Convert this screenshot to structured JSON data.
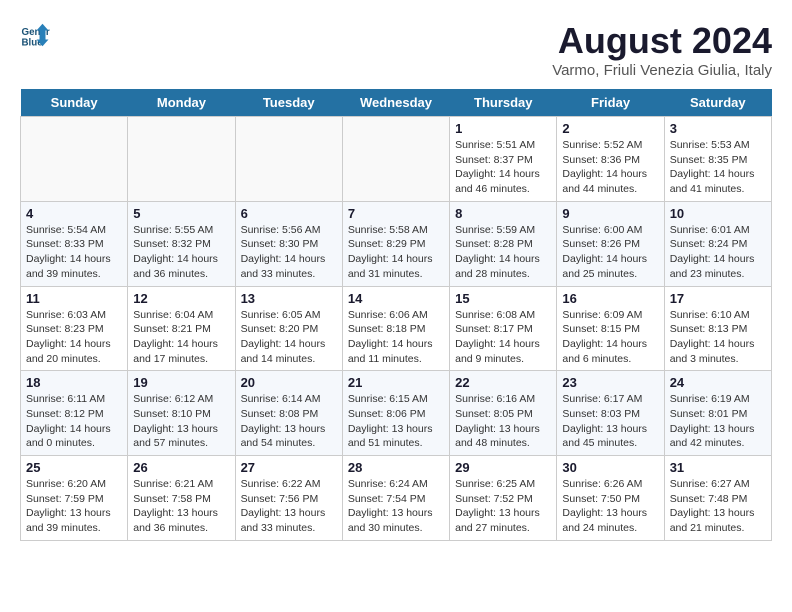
{
  "header": {
    "logo_line1": "General",
    "logo_line2": "Blue",
    "month_year": "August 2024",
    "location": "Varmo, Friuli Venezia Giulia, Italy"
  },
  "days_of_week": [
    "Sunday",
    "Monday",
    "Tuesday",
    "Wednesday",
    "Thursday",
    "Friday",
    "Saturday"
  ],
  "weeks": [
    [
      {
        "day": "",
        "info": ""
      },
      {
        "day": "",
        "info": ""
      },
      {
        "day": "",
        "info": ""
      },
      {
        "day": "",
        "info": ""
      },
      {
        "day": "1",
        "info": "Sunrise: 5:51 AM\nSunset: 8:37 PM\nDaylight: 14 hours and 46 minutes."
      },
      {
        "day": "2",
        "info": "Sunrise: 5:52 AM\nSunset: 8:36 PM\nDaylight: 14 hours and 44 minutes."
      },
      {
        "day": "3",
        "info": "Sunrise: 5:53 AM\nSunset: 8:35 PM\nDaylight: 14 hours and 41 minutes."
      }
    ],
    [
      {
        "day": "4",
        "info": "Sunrise: 5:54 AM\nSunset: 8:33 PM\nDaylight: 14 hours and 39 minutes."
      },
      {
        "day": "5",
        "info": "Sunrise: 5:55 AM\nSunset: 8:32 PM\nDaylight: 14 hours and 36 minutes."
      },
      {
        "day": "6",
        "info": "Sunrise: 5:56 AM\nSunset: 8:30 PM\nDaylight: 14 hours and 33 minutes."
      },
      {
        "day": "7",
        "info": "Sunrise: 5:58 AM\nSunset: 8:29 PM\nDaylight: 14 hours and 31 minutes."
      },
      {
        "day": "8",
        "info": "Sunrise: 5:59 AM\nSunset: 8:28 PM\nDaylight: 14 hours and 28 minutes."
      },
      {
        "day": "9",
        "info": "Sunrise: 6:00 AM\nSunset: 8:26 PM\nDaylight: 14 hours and 25 minutes."
      },
      {
        "day": "10",
        "info": "Sunrise: 6:01 AM\nSunset: 8:24 PM\nDaylight: 14 hours and 23 minutes."
      }
    ],
    [
      {
        "day": "11",
        "info": "Sunrise: 6:03 AM\nSunset: 8:23 PM\nDaylight: 14 hours and 20 minutes."
      },
      {
        "day": "12",
        "info": "Sunrise: 6:04 AM\nSunset: 8:21 PM\nDaylight: 14 hours and 17 minutes."
      },
      {
        "day": "13",
        "info": "Sunrise: 6:05 AM\nSunset: 8:20 PM\nDaylight: 14 hours and 14 minutes."
      },
      {
        "day": "14",
        "info": "Sunrise: 6:06 AM\nSunset: 8:18 PM\nDaylight: 14 hours and 11 minutes."
      },
      {
        "day": "15",
        "info": "Sunrise: 6:08 AM\nSunset: 8:17 PM\nDaylight: 14 hours and 9 minutes."
      },
      {
        "day": "16",
        "info": "Sunrise: 6:09 AM\nSunset: 8:15 PM\nDaylight: 14 hours and 6 minutes."
      },
      {
        "day": "17",
        "info": "Sunrise: 6:10 AM\nSunset: 8:13 PM\nDaylight: 14 hours and 3 minutes."
      }
    ],
    [
      {
        "day": "18",
        "info": "Sunrise: 6:11 AM\nSunset: 8:12 PM\nDaylight: 14 hours and 0 minutes."
      },
      {
        "day": "19",
        "info": "Sunrise: 6:12 AM\nSunset: 8:10 PM\nDaylight: 13 hours and 57 minutes."
      },
      {
        "day": "20",
        "info": "Sunrise: 6:14 AM\nSunset: 8:08 PM\nDaylight: 13 hours and 54 minutes."
      },
      {
        "day": "21",
        "info": "Sunrise: 6:15 AM\nSunset: 8:06 PM\nDaylight: 13 hours and 51 minutes."
      },
      {
        "day": "22",
        "info": "Sunrise: 6:16 AM\nSunset: 8:05 PM\nDaylight: 13 hours and 48 minutes."
      },
      {
        "day": "23",
        "info": "Sunrise: 6:17 AM\nSunset: 8:03 PM\nDaylight: 13 hours and 45 minutes."
      },
      {
        "day": "24",
        "info": "Sunrise: 6:19 AM\nSunset: 8:01 PM\nDaylight: 13 hours and 42 minutes."
      }
    ],
    [
      {
        "day": "25",
        "info": "Sunrise: 6:20 AM\nSunset: 7:59 PM\nDaylight: 13 hours and 39 minutes."
      },
      {
        "day": "26",
        "info": "Sunrise: 6:21 AM\nSunset: 7:58 PM\nDaylight: 13 hours and 36 minutes."
      },
      {
        "day": "27",
        "info": "Sunrise: 6:22 AM\nSunset: 7:56 PM\nDaylight: 13 hours and 33 minutes."
      },
      {
        "day": "28",
        "info": "Sunrise: 6:24 AM\nSunset: 7:54 PM\nDaylight: 13 hours and 30 minutes."
      },
      {
        "day": "29",
        "info": "Sunrise: 6:25 AM\nSunset: 7:52 PM\nDaylight: 13 hours and 27 minutes."
      },
      {
        "day": "30",
        "info": "Sunrise: 6:26 AM\nSunset: 7:50 PM\nDaylight: 13 hours and 24 minutes."
      },
      {
        "day": "31",
        "info": "Sunrise: 6:27 AM\nSunset: 7:48 PM\nDaylight: 13 hours and 21 minutes."
      }
    ]
  ]
}
